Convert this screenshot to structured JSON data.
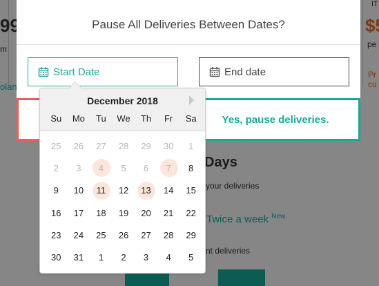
{
  "background": {
    "left_price": "99",
    "left_unit": "m",
    "left_link": "olan",
    "right_header": "IT",
    "right_price": "$5",
    "right_unit": "pe",
    "right_link": "Pr cu",
    "heading": "Days",
    "your_deliveries": "your deliveries",
    "twice_a_week": "Twice a week",
    "new_badge": "New",
    "nt_deliveries": "nt deliveries"
  },
  "modal": {
    "title": "Pause All Deliveries Between Dates?",
    "start_placeholder": "Start Date",
    "end_placeholder": "End date",
    "confirm_label": "Yes, pause deliveries."
  },
  "datepicker": {
    "month_label": "December 2018",
    "weekdays": [
      "Su",
      "Mo",
      "Tu",
      "We",
      "Th",
      "Fr",
      "Sa"
    ],
    "weeks": [
      [
        {
          "d": "25",
          "muted": true
        },
        {
          "d": "26",
          "muted": true
        },
        {
          "d": "27",
          "muted": true
        },
        {
          "d": "28",
          "muted": true
        },
        {
          "d": "29",
          "muted": true
        },
        {
          "d": "30",
          "muted": true
        },
        {
          "d": "1",
          "muted": true
        }
      ],
      [
        {
          "d": "2",
          "muted": true
        },
        {
          "d": "3",
          "muted": true
        },
        {
          "d": "4",
          "muted": true,
          "highlight": true
        },
        {
          "d": "5",
          "muted": true
        },
        {
          "d": "6",
          "muted": true
        },
        {
          "d": "7",
          "muted": true,
          "highlight": true
        },
        {
          "d": "8"
        }
      ],
      [
        {
          "d": "9"
        },
        {
          "d": "10"
        },
        {
          "d": "11",
          "highlight": true
        },
        {
          "d": "12"
        },
        {
          "d": "13",
          "highlight": true
        },
        {
          "d": "14"
        },
        {
          "d": "15"
        }
      ],
      [
        {
          "d": "16"
        },
        {
          "d": "17"
        },
        {
          "d": "18"
        },
        {
          "d": "19"
        },
        {
          "d": "20"
        },
        {
          "d": "21"
        },
        {
          "d": "22"
        }
      ],
      [
        {
          "d": "23"
        },
        {
          "d": "24"
        },
        {
          "d": "25"
        },
        {
          "d": "26"
        },
        {
          "d": "27"
        },
        {
          "d": "28"
        },
        {
          "d": "29"
        }
      ],
      [
        {
          "d": "30"
        },
        {
          "d": "31"
        },
        {
          "d": "1"
        },
        {
          "d": "2"
        },
        {
          "d": "3"
        },
        {
          "d": "4"
        },
        {
          "d": "5"
        }
      ]
    ]
  },
  "colors": {
    "accent": "#19a89a",
    "danger": "#ef5a5a",
    "highlight": "#fce6db",
    "brand_orange": "#e26a1c"
  },
  "icons": {
    "start_calendar": "calendar-icon",
    "end_calendar": "calendar-icon",
    "next_month": "chevron-right-icon"
  }
}
